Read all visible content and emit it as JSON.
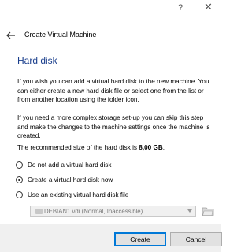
{
  "window": {
    "help_label": "?",
    "close_label": "✕"
  },
  "header": {
    "title": "Create Virtual Machine"
  },
  "page": {
    "title": "Hard disk",
    "description1": "If you wish you can add a virtual hard disk to the new machine. You can either create a new hard disk file or select one from the list or from another location using the folder icon.",
    "description2": "If you need a more complex storage set-up you can skip this step and make the changes to the machine settings once the machine is created.",
    "recommend_prefix": "The recommended size of the hard disk is ",
    "recommend_size": "8,00 GB",
    "recommend_suffix": "."
  },
  "options": [
    {
      "label": "Do not add a virtual hard disk",
      "checked": false
    },
    {
      "label": "Create a virtual hard disk now",
      "checked": true
    },
    {
      "label": "Use an existing virtual hard disk file",
      "checked": false
    }
  ],
  "existing_disk": {
    "selected": "DEBIAN1.vdi (Normal, Inaccessible)",
    "enabled": false
  },
  "buttons": {
    "create": "Create",
    "cancel": "Cancel"
  }
}
